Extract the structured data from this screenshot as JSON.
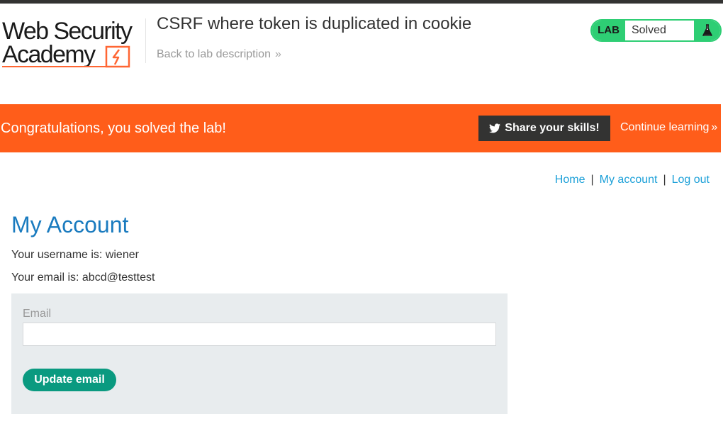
{
  "header": {
    "logo_line1": "Web Security",
    "logo_line2": "Academy",
    "lab_title": "CSRF where token is duplicated in cookie",
    "back_link": "Back to lab description",
    "back_chevron": "»",
    "lab_badge": {
      "tag": "LAB",
      "status": "Solved",
      "icon": "flask-icon",
      "color": "#2ece74"
    }
  },
  "banner": {
    "message": "Congratulations, you solved the lab!",
    "share_label": "Share your skills!",
    "share_icon": "twitter-icon",
    "continue_label": "Continue learning",
    "continue_chevron": "»",
    "color": "#ff5d1a"
  },
  "nav": {
    "items": [
      "Home",
      "My account",
      "Log out"
    ],
    "separator": "|"
  },
  "main": {
    "title": "My Account",
    "username_line": "Your username is: wiener",
    "email_line": "Your email is: abcd@testtest",
    "form": {
      "email_label": "Email",
      "email_value": "",
      "submit_label": "Update email"
    }
  },
  "colors": {
    "title_blue": "#1a7bbf",
    "link_blue": "#1ca0d8",
    "button_green": "#0a9a80"
  }
}
